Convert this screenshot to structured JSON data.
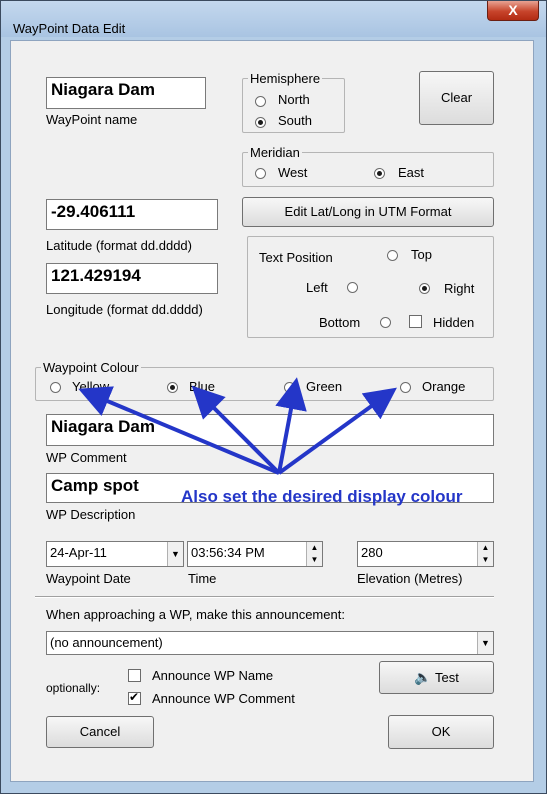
{
  "window": {
    "title": "WayPoint Data Edit",
    "close_glyph": "X"
  },
  "waypoint": {
    "name_value": "Niagara Dam",
    "name_label": "WayPoint name"
  },
  "hemisphere": {
    "label": "Hemisphere",
    "options": [
      "North",
      "South"
    ],
    "selected": "South"
  },
  "clear_button": "Clear",
  "meridian": {
    "label": "Meridian",
    "options": [
      "West",
      "East"
    ],
    "selected": "East"
  },
  "utm_button": "Edit Lat/Long in UTM Format",
  "latitude": {
    "value": "-29.406111",
    "label": "Latitude (format dd.dddd)"
  },
  "longitude": {
    "value": "121.429194",
    "label": "Longitude (format dd.dddd)"
  },
  "text_position": {
    "label": "Text Position",
    "top": "Top",
    "left": "Left",
    "right": "Right",
    "bottom": "Bottom",
    "hidden": "Hidden",
    "selected": "Right"
  },
  "colour": {
    "label": "Waypoint Colour",
    "options": [
      "Yellow",
      "Blue",
      "Green",
      "Orange"
    ],
    "selected": "Blue"
  },
  "comment": {
    "value": "Niagara Dam",
    "label": "WP Comment"
  },
  "description": {
    "value": "Camp spot",
    "label": "WP Description"
  },
  "date": {
    "value": "24-Apr-11",
    "label": "Waypoint Date"
  },
  "time": {
    "value": "03:56:34 PM",
    "label": "Time"
  },
  "elevation": {
    "value": "280",
    "label": "Elevation (Metres)"
  },
  "announcement": {
    "label": "When approaching a WP, make this announcement:",
    "value": "(no announcement)",
    "optionally": "optionally:",
    "announce_name": "Announce WP Name",
    "announce_comment": "Announce WP Comment",
    "announce_name_checked": false,
    "announce_comment_checked": true
  },
  "test_button": "Test",
  "cancel_button": "Cancel",
  "ok_button": "OK",
  "annotation": "Also set the desired display colour",
  "colors": {
    "annotation": "#2436c8",
    "titlebar": "#b4cde6",
    "close": "#c7442b"
  }
}
